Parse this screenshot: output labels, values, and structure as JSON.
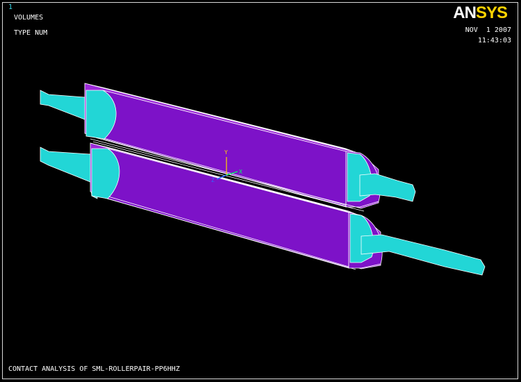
{
  "window_number": "1",
  "plot_labels": [
    "VOLUMES",
    "TYPE NUM"
  ],
  "logo": {
    "left": "AN",
    "right": "SYS"
  },
  "date": "NOV  1 2007",
  "time": "11:43:03",
  "footer_title": "CONTACT ANALYSIS OF SML-ROLLERPAIR-PP6HHZ",
  "triad": {
    "y_label": "Y",
    "x_label": "X",
    "z_label": "Z"
  },
  "colors": {
    "background": "#000000",
    "roller_body": "#7d12c8",
    "shaft": "#22d6d6",
    "edges": "#ffffff",
    "logo_an": "#ffffff",
    "logo_sys": "#ffd400"
  }
}
